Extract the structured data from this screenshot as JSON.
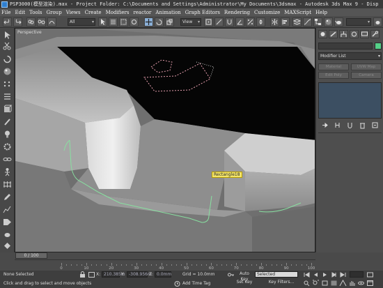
{
  "window": {
    "title": "PSP3000(模型渲染).max - Project Folder: C:\\Documents and Settings\\Administrator\\My Documents\\3dsmax - Autodesk 3ds Max 9 - Disp"
  },
  "menu": {
    "items": [
      "File",
      "Edit",
      "Tools",
      "Group",
      "Views",
      "Create",
      "Modifiers",
      "reactor",
      "Animation",
      "Graph Editors",
      "Rendering",
      "Customize",
      "MAXScript",
      "Help"
    ]
  },
  "toolbar": {
    "selection_filter": "All",
    "reference_coord": "View"
  },
  "viewport": {
    "label": "Perspective",
    "object_tooltip": "Rectangle18"
  },
  "command_panel": {
    "modifier_list": "Modifier List",
    "buttons": [
      "Material",
      "UVW Map",
      "Edit Poly",
      "Camera"
    ],
    "object_color": "#55d088"
  },
  "timeline": {
    "slider_label": "0 / 100",
    "ticks": [
      "0",
      "10",
      "20",
      "30",
      "40",
      "50",
      "60",
      "70",
      "80",
      "90",
      "100"
    ]
  },
  "status": {
    "selection": "None Selected",
    "prompt": "Click and drag to select and move objects",
    "x_value": "210.385m",
    "y_value": "-308.956m",
    "z_value": "0.0mm",
    "grid": "Grid = 10.0mm",
    "add_time_tag": "Add Time Tag",
    "auto_key": "Auto Key",
    "auto_key_mode": "Selected",
    "set_key": "Set Key",
    "key_filters": "Key Filters..."
  }
}
